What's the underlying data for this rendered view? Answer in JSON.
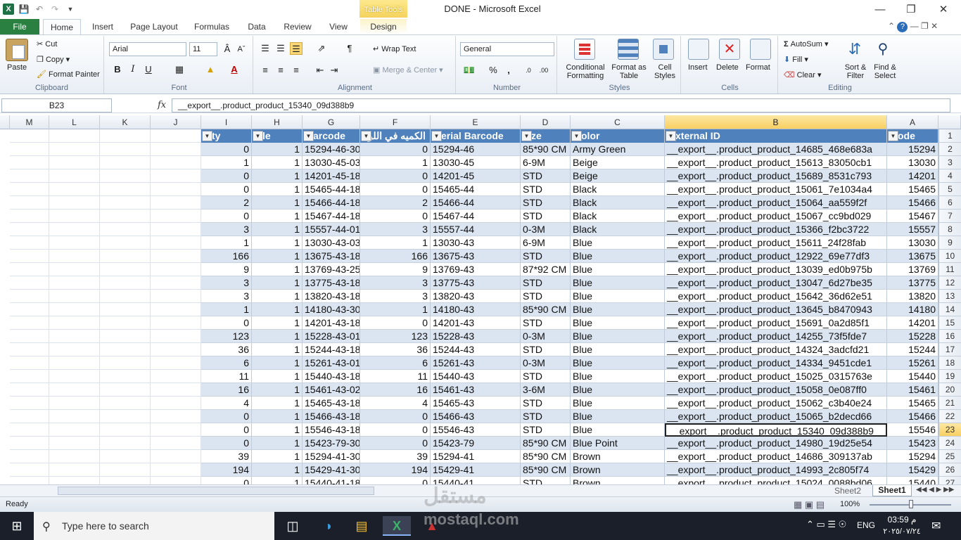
{
  "window": {
    "title": "DONE  -  Microsoft Excel",
    "contextual_tab": "Table Tools"
  },
  "tabs": [
    "File",
    "Home",
    "Insert",
    "Page Layout",
    "Formulas",
    "Data",
    "Review",
    "View",
    "Design"
  ],
  "clipboard": {
    "paste": "Paste",
    "cut": "Cut",
    "copy": "Copy",
    "format_painter": "Format Painter",
    "label": "Clipboard"
  },
  "font": {
    "name": "Arial",
    "size": "11",
    "label": "Font",
    "bold": "B",
    "italic": "I",
    "underline": "U"
  },
  "alignment": {
    "wrap": "Wrap Text",
    "merge": "Merge & Center",
    "label": "Alignment"
  },
  "number": {
    "format": "General",
    "label": "Number",
    "percent": "%",
    "comma": ","
  },
  "styles": {
    "conditional": "Conditional Formatting",
    "format_table": "Format as Table",
    "cell_styles": "Cell Styles",
    "label": "Styles"
  },
  "cells": {
    "insert": "Insert",
    "delete": "Delete",
    "format": "Format",
    "label": "Cells"
  },
  "editing": {
    "autosum": "AutoSum",
    "fill": "Fill",
    "clear": "Clear",
    "sort": "Sort & Filter",
    "find": "Find & Select",
    "label": "Editing"
  },
  "formula_bar": {
    "name_box": "B23",
    "fx": "fx",
    "formula": "__export__.product_product_15340_09d388b9"
  },
  "columns": [
    "M",
    "L",
    "K",
    "J",
    "I",
    "H",
    "G",
    "F",
    "E",
    "D",
    "C",
    "B",
    "A"
  ],
  "headers": {
    "I": "ty",
    "H": "le",
    "G": "arcode",
    "F": "الكميه في اللون",
    "E": "erial Barcode",
    "D": "ze",
    "C": "olor",
    "B": "xternal ID",
    "A": "ode"
  },
  "rows": [
    {
      "n": "2",
      "I": "0",
      "H": "1",
      "G": "15294-46-30",
      "F": "0",
      "E": "15294-46",
      "D": "85*90 CM",
      "C": "Army Green",
      "B": "__export__.product_product_14685_468e683a",
      "A": "15294"
    },
    {
      "n": "3",
      "I": "1",
      "H": "1",
      "G": "13030-45-03",
      "F": "1",
      "E": "13030-45",
      "D": "6-9M",
      "C": "Beige",
      "B": "__export__.product_product_15613_83050cb1",
      "A": "13030"
    },
    {
      "n": "4",
      "I": "0",
      "H": "1",
      "G": "14201-45-18",
      "F": "0",
      "E": "14201-45",
      "D": "STD",
      "C": "Beige",
      "B": "__export__.product_product_15689_8531c793",
      "A": "14201"
    },
    {
      "n": "5",
      "I": "0",
      "H": "1",
      "G": "15465-44-18",
      "F": "0",
      "E": "15465-44",
      "D": "STD",
      "C": "Black",
      "B": "__export__.product_product_15061_7e1034a4",
      "A": "15465"
    },
    {
      "n": "6",
      "I": "2",
      "H": "1",
      "G": "15466-44-18",
      "F": "2",
      "E": "15466-44",
      "D": "STD",
      "C": "Black",
      "B": "__export__.product_product_15064_aa559f2f",
      "A": "15466"
    },
    {
      "n": "7",
      "I": "0",
      "H": "1",
      "G": "15467-44-18",
      "F": "0",
      "E": "15467-44",
      "D": "STD",
      "C": "Black",
      "B": "__export__.product_product_15067_cc9bd029",
      "A": "15467"
    },
    {
      "n": "8",
      "I": "3",
      "H": "1",
      "G": "15557-44-01",
      "F": "3",
      "E": "15557-44",
      "D": "0-3M",
      "C": "Black",
      "B": "__export__.product_product_15366_f2bc3722",
      "A": "15557"
    },
    {
      "n": "9",
      "I": "1",
      "H": "1",
      "G": "13030-43-03",
      "F": "1",
      "E": "13030-43",
      "D": "6-9M",
      "C": "Blue",
      "B": "__export__.product_product_15611_24f28fab",
      "A": "13030"
    },
    {
      "n": "10",
      "I": "166",
      "H": "1",
      "G": "13675-43-18",
      "F": "166",
      "E": "13675-43",
      "D": "STD",
      "C": "Blue",
      "B": "__export__.product_product_12922_69e77df3",
      "A": "13675"
    },
    {
      "n": "11",
      "I": "9",
      "H": "1",
      "G": "13769-43-25",
      "F": "9",
      "E": "13769-43",
      "D": "87*92 CM",
      "C": "Blue",
      "B": "__export__.product_product_13039_ed0b975b",
      "A": "13769"
    },
    {
      "n": "12",
      "I": "3",
      "H": "1",
      "G": "13775-43-18",
      "F": "3",
      "E": "13775-43",
      "D": "STD",
      "C": "Blue",
      "B": "__export__.product_product_13047_6d27be35",
      "A": "13775"
    },
    {
      "n": "13",
      "I": "3",
      "H": "1",
      "G": "13820-43-18",
      "F": "3",
      "E": "13820-43",
      "D": "STD",
      "C": "Blue",
      "B": "__export__.product_product_15642_36d62e51",
      "A": "13820"
    },
    {
      "n": "14",
      "I": "1",
      "H": "1",
      "G": "14180-43-30",
      "F": "1",
      "E": "14180-43",
      "D": "85*90 CM",
      "C": "Blue",
      "B": "__export__.product_product_13645_b8470943",
      "A": "14180"
    },
    {
      "n": "15",
      "I": "0",
      "H": "1",
      "G": "14201-43-18",
      "F": "0",
      "E": "14201-43",
      "D": "STD",
      "C": "Blue",
      "B": "__export__.product_product_15691_0a2d85f1",
      "A": "14201"
    },
    {
      "n": "16",
      "I": "123",
      "H": "1",
      "G": "15228-43-01",
      "F": "123",
      "E": "15228-43",
      "D": "0-3M",
      "C": "Blue",
      "B": "__export__.product_product_14255_73f5fde7",
      "A": "15228"
    },
    {
      "n": "17",
      "I": "36",
      "H": "1",
      "G": "15244-43-18",
      "F": "36",
      "E": "15244-43",
      "D": "STD",
      "C": "Blue",
      "B": "__export__.product_product_14324_3adcfd21",
      "A": "15244"
    },
    {
      "n": "18",
      "I": "6",
      "H": "1",
      "G": "15261-43-01",
      "F": "6",
      "E": "15261-43",
      "D": "0-3M",
      "C": "Blue",
      "B": "__export__.product_product_14334_9451cde1",
      "A": "15261"
    },
    {
      "n": "19",
      "I": "11",
      "H": "1",
      "G": "15440-43-18",
      "F": "11",
      "E": "15440-43",
      "D": "STD",
      "C": "Blue",
      "B": "__export__.product_product_15025_0315763e",
      "A": "15440"
    },
    {
      "n": "20",
      "I": "16",
      "H": "1",
      "G": "15461-43-02",
      "F": "16",
      "E": "15461-43",
      "D": "3-6M",
      "C": "Blue",
      "B": "__export__.product_product_15058_0e087ff0",
      "A": "15461"
    },
    {
      "n": "21",
      "I": "4",
      "H": "1",
      "G": "15465-43-18",
      "F": "4",
      "E": "15465-43",
      "D": "STD",
      "C": "Blue",
      "B": "__export__.product_product_15062_c3b40e24",
      "A": "15465"
    },
    {
      "n": "22",
      "I": "0",
      "H": "1",
      "G": "15466-43-18",
      "F": "0",
      "E": "15466-43",
      "D": "STD",
      "C": "Blue",
      "B": "__export__.product_product_15065_b2decd66",
      "A": "15466"
    },
    {
      "n": "23",
      "I": "0",
      "H": "1",
      "G": "15546-43-18",
      "F": "0",
      "E": "15546-43",
      "D": "STD",
      "C": "Blue",
      "B": "__export__.product_product_15340_09d388b9",
      "A": "15546"
    },
    {
      "n": "24",
      "I": "0",
      "H": "1",
      "G": "15423-79-30",
      "F": "0",
      "E": "15423-79",
      "D": "85*90 CM",
      "C": "Blue Point",
      "B": "__export__.product_product_14980_19d25e54",
      "A": "15423"
    },
    {
      "n": "25",
      "I": "39",
      "H": "1",
      "G": "15294-41-30",
      "F": "39",
      "E": "15294-41",
      "D": "85*90 CM",
      "C": "Brown",
      "B": "__export__.product_product_14686_309137ab",
      "A": "15294"
    },
    {
      "n": "26",
      "I": "194",
      "H": "1",
      "G": "15429-41-30",
      "F": "194",
      "E": "15429-41",
      "D": "85*90 CM",
      "C": "Brown",
      "B": "__export__.product_product_14993_2c805f74",
      "A": "15429"
    },
    {
      "n": "27",
      "I": "0",
      "H": "1",
      "G": "15440-41-18",
      "F": "0",
      "E": "15440-41",
      "D": "STD",
      "C": "Brown",
      "B": "__export__.product_product_15024_0088bd06",
      "A": "15440"
    }
  ],
  "header_row_number": "1",
  "sheets": [
    "Sheet2",
    "Sheet1"
  ],
  "status": {
    "ready": "Ready",
    "zoom": "100%"
  },
  "taskbar": {
    "search_placeholder": "Type here to search",
    "lang": "ENG",
    "time": "03:59 م",
    "date": "٢٠٢٥/٠٧/٢٤"
  },
  "watermark": {
    "brand": "مستقل",
    "site": "mostaql.com"
  },
  "colors": {
    "accent": "#4f81bd",
    "band": "#dbe5f1",
    "file_tab": "#2a8040",
    "selected_header": "#f8cf62"
  }
}
